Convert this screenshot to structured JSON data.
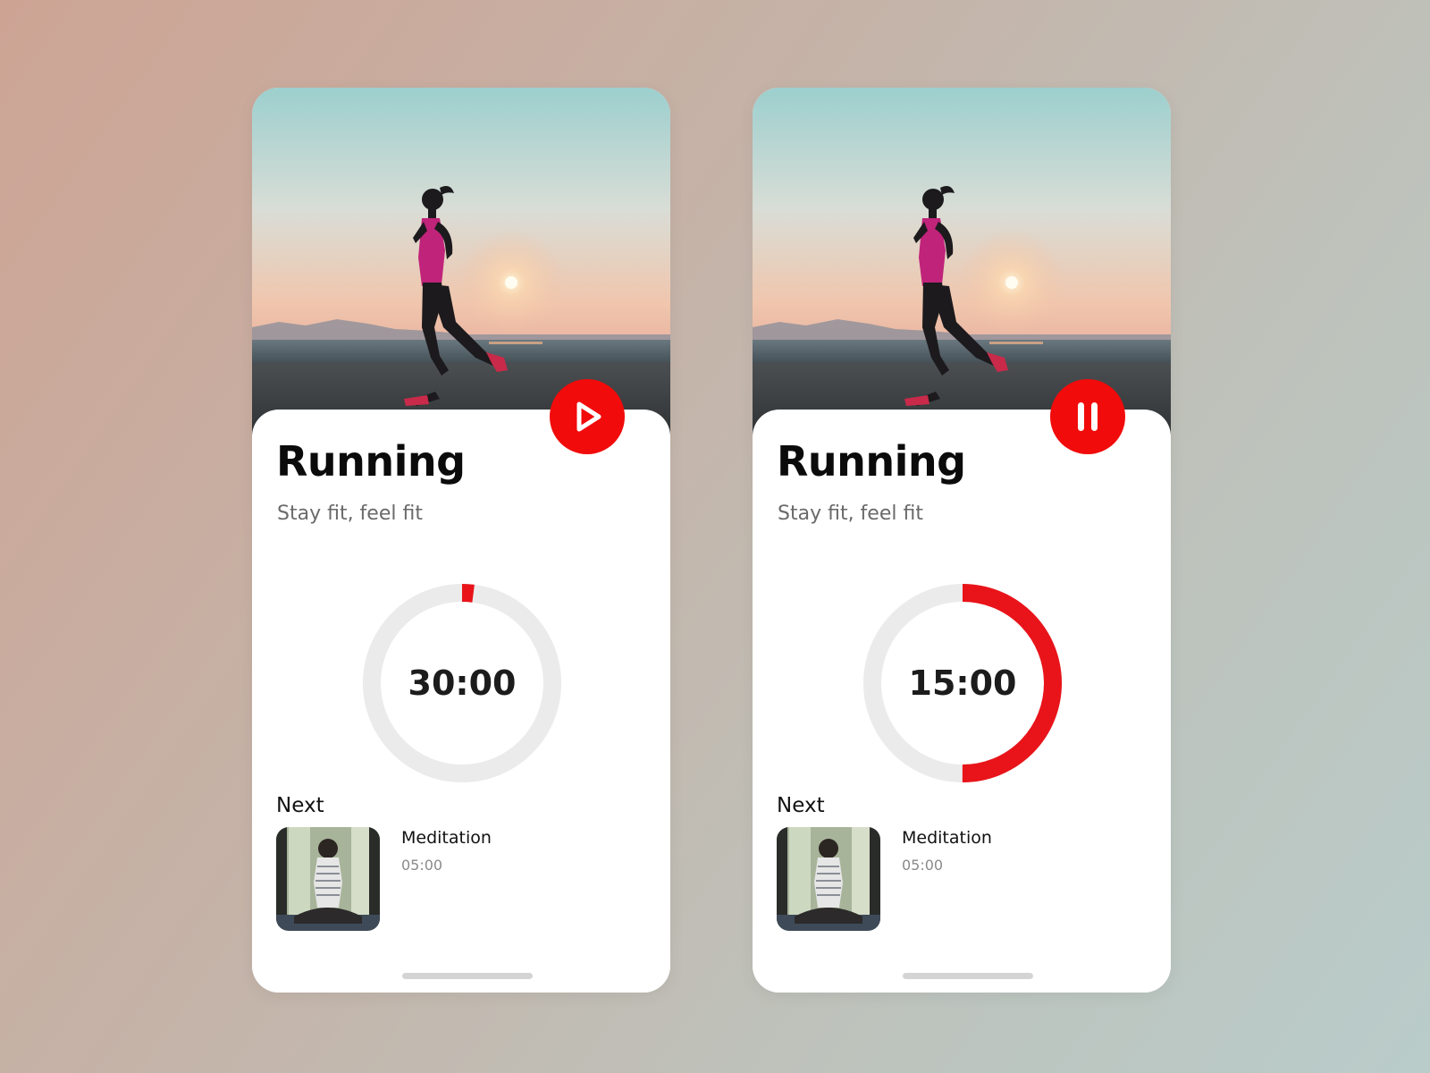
{
  "cards": [
    {
      "state": "paused",
      "control_icon": "play-icon",
      "title": "Running",
      "subtitle": "Stay fit, feel fit",
      "timer": "30:00",
      "progress": 0.02,
      "next_label": "Next",
      "next": {
        "title": "Meditation",
        "duration": "05:00"
      }
    },
    {
      "state": "playing",
      "control_icon": "pause-icon",
      "title": "Running",
      "subtitle": "Stay fit, feel fit",
      "timer": "15:00",
      "progress": 0.5,
      "next_label": "Next",
      "next": {
        "title": "Meditation",
        "duration": "05:00"
      }
    }
  ],
  "colors": {
    "accent": "#f10b0b",
    "ring_track": "#ebebeb",
    "ring_progress": "#e8141a"
  }
}
